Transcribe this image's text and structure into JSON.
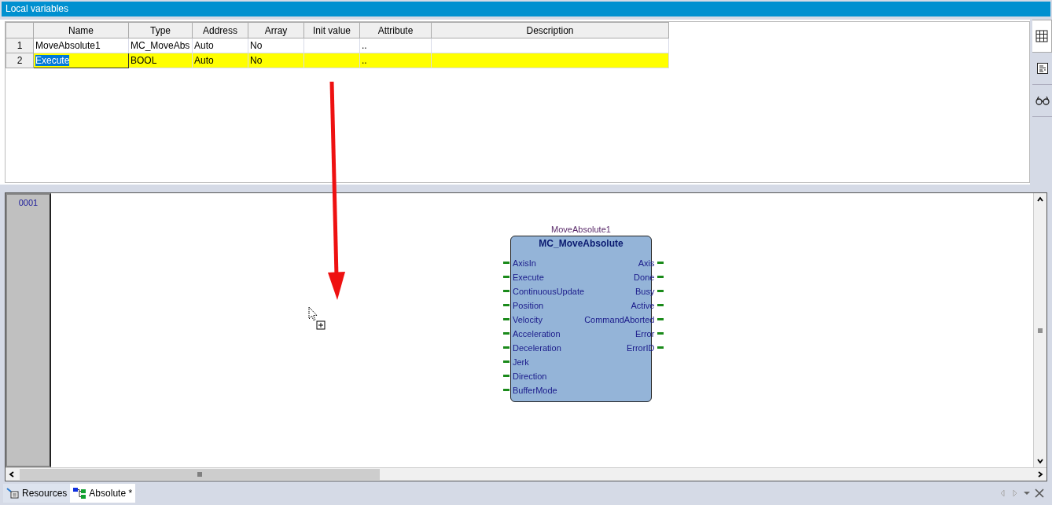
{
  "panel": {
    "title": "Local variables"
  },
  "table": {
    "columns": [
      "",
      "Name",
      "Type",
      "Address",
      "Array",
      "Init value",
      "Attribute",
      "Description"
    ],
    "rows": [
      {
        "cells": [
          "1",
          "MoveAbsolute1",
          "MC_MoveAbs",
          "Auto",
          "No",
          "",
          "..",
          ""
        ],
        "selected": false,
        "editing": false
      },
      {
        "cells": [
          "2",
          "Execute",
          "BOOL",
          "Auto",
          "No",
          "",
          "..",
          ""
        ],
        "selected": true,
        "editing": true
      }
    ]
  },
  "side_tabs": [
    {
      "kind": "grid",
      "selected": true
    },
    {
      "kind": "text",
      "selected": false
    },
    {
      "kind": "watch",
      "selected": false
    }
  ],
  "diagram": {
    "network_number": "0001",
    "block": {
      "instance": "MoveAbsolute1",
      "type": "MC_MoveAbsolute",
      "inputs": [
        "AxisIn",
        "Execute",
        "ContinuousUpdate",
        "Position",
        "Velocity",
        "Acceleration",
        "Deceleration",
        "Jerk",
        "Direction",
        "BufferMode"
      ],
      "outputs": [
        "Axis",
        "Done",
        "Busy",
        "Active",
        "CommandAborted",
        "Error",
        "ErrorID"
      ]
    }
  },
  "bottom_tabs": [
    {
      "kind": "resources",
      "label": "Resources",
      "selected": false
    },
    {
      "kind": "program",
      "label": "Absolute *",
      "selected": true
    }
  ]
}
